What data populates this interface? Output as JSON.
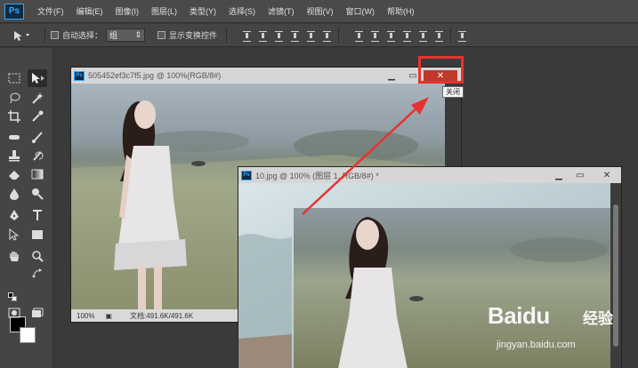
{
  "app": {
    "logo": "Ps"
  },
  "menu": [
    "文件(F)",
    "编辑(E)",
    "图像(I)",
    "图层(L)",
    "类型(Y)",
    "选择(S)",
    "滤镜(T)",
    "视图(V)",
    "窗口(W)",
    "帮助(H)"
  ],
  "options": {
    "auto_select_label": "自动选择：",
    "auto_select_value": "组",
    "show_transform_label": "显示变换控件"
  },
  "documents": [
    {
      "title": "505452ef3c7f5.jpg @ 100%(RGB/8#)",
      "zoom": "100%",
      "doc_size": "文档:491.6K/491.6K"
    },
    {
      "title": "10.jpg @ 100% (图层 1, RGB/8#) *"
    }
  ],
  "tooltip": {
    "text": "关闭"
  },
  "watermark": {
    "brand": "Baidu",
    "brand_cn": "经验",
    "url": "jingyan.baidu.com"
  },
  "colors": {
    "highlight": "#e8322f",
    "ps_blue": "#31a8ff"
  }
}
